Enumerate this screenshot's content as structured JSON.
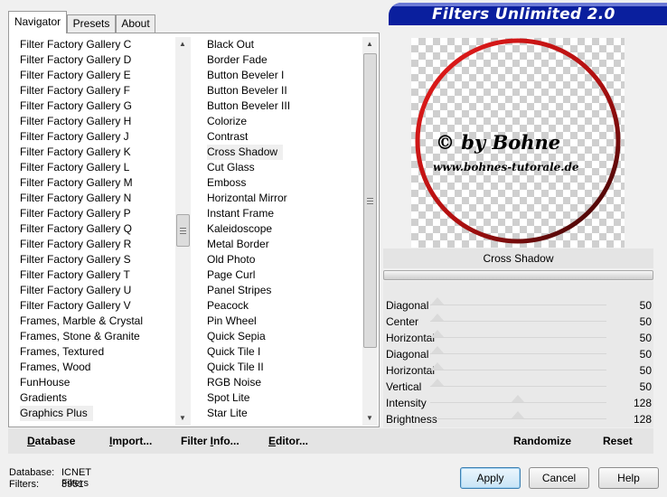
{
  "banner_title": "Filters Unlimited 2.0",
  "tabs": [
    "Navigator",
    "Presets",
    "About"
  ],
  "categories": [
    "Filter Factory Gallery C",
    "Filter Factory Gallery D",
    "Filter Factory Gallery E",
    "Filter Factory Gallery F",
    "Filter Factory Gallery G",
    "Filter Factory Gallery H",
    "Filter Factory Gallery J",
    "Filter Factory Gallery K",
    "Filter Factory Gallery L",
    "Filter Factory Gallery M",
    "Filter Factory Gallery N",
    "Filter Factory Gallery P",
    "Filter Factory Gallery Q",
    "Filter Factory Gallery R",
    "Filter Factory Gallery S",
    "Filter Factory Gallery T",
    "Filter Factory Gallery U",
    "Filter Factory Gallery V",
    "Frames, Marble & Crystal",
    "Frames, Stone & Granite",
    "Frames, Textured",
    "Frames, Wood",
    "FunHouse",
    "Gradients",
    "Graphics Plus"
  ],
  "selected_category": "Graphics Plus",
  "filters": [
    "Black Out",
    "Border Fade",
    "Button Beveler I",
    "Button Beveler II",
    "Button Beveler III",
    "Colorize",
    "Contrast",
    "Cross Shadow",
    "Cut Glass",
    "Emboss",
    "Horizontal Mirror",
    "Instant Frame",
    "Kaleidoscope",
    "Metal Border",
    "Old Photo",
    "Page Curl",
    "Panel Stripes",
    "Peacock",
    "Pin Wheel",
    "Quick Sepia",
    "Quick Tile I",
    "Quick Tile II",
    "RGB Noise",
    "Spot Lite",
    "Star Lite"
  ],
  "selected_filter": "Cross Shadow",
  "preview": {
    "watermark_line1": "© by Bohne",
    "watermark_line2": "www.bohnes-tutorale.de"
  },
  "effect_name": "Cross Shadow",
  "params": [
    {
      "label": "Diagonal",
      "value": "50"
    },
    {
      "label": "Center",
      "value": "50"
    },
    {
      "label": "Horizontal",
      "value": "50"
    },
    {
      "label": "Diagonal",
      "value": "50"
    },
    {
      "label": "Horizontal",
      "value": "50"
    },
    {
      "label": "Vertical",
      "value": "50"
    },
    {
      "label": "Intensity",
      "value": "128"
    },
    {
      "label": "Brightness",
      "value": "128"
    }
  ],
  "toolbar": {
    "database": {
      "u": "D",
      "rest": "atabase"
    },
    "import": {
      "u": "I",
      "rest": "mport..."
    },
    "filter_info": {
      "pre": "Filter ",
      "u": "I",
      "rest": "nfo..."
    },
    "editor": {
      "u": "E",
      "rest": "ditor..."
    },
    "randomize": "Randomize",
    "reset": "Reset"
  },
  "status": {
    "database_label": "Database:",
    "database_value": "ICNET Filters",
    "filters_label": "Filters:",
    "filters_value": "3951"
  },
  "buttons": {
    "apply": "Apply",
    "cancel": "Cancel",
    "help": "Help"
  },
  "colors": {
    "banner": "#0a1f9e",
    "accent_button": "#3c7fb1",
    "ring_red": "#d41414",
    "ring_dark": "#2a0505"
  }
}
